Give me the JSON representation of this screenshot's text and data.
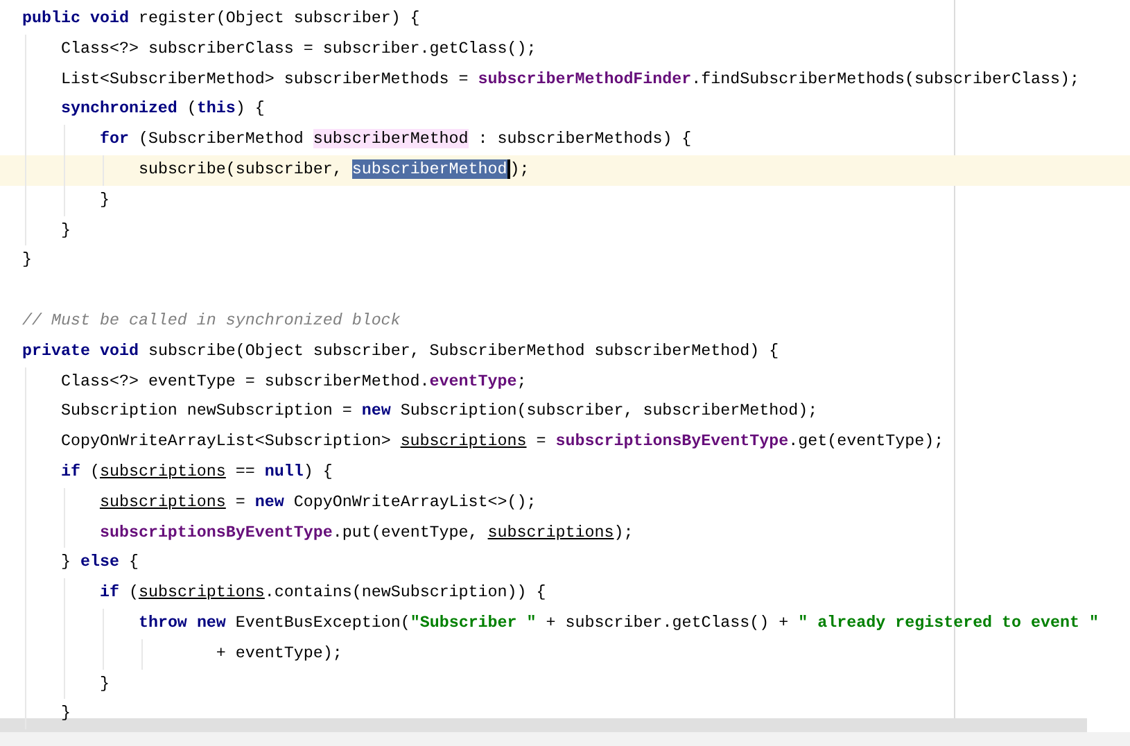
{
  "editor": {
    "lines": [
      {
        "current": false,
        "tokens": [
          {
            "kind": "keyword",
            "text": "public "
          },
          {
            "kind": "keyword",
            "text": "void"
          },
          {
            "kind": "plain",
            "text": " register(Object subscriber) {"
          }
        ]
      },
      {
        "current": false,
        "tokens": [
          {
            "kind": "plain",
            "text": "    Class<?> subscriberClass = subscriber.getClass();"
          }
        ]
      },
      {
        "current": false,
        "tokens": [
          {
            "kind": "plain",
            "text": "    List<SubscriberMethod> subscriberMethods = "
          },
          {
            "kind": "field",
            "text": "subscriberMethodFinder"
          },
          {
            "kind": "plain",
            "text": ".findSubscriberMethods(subscriberClass);"
          }
        ]
      },
      {
        "current": false,
        "tokens": [
          {
            "kind": "keyword",
            "text": "    synchronized"
          },
          {
            "kind": "plain",
            "text": " ("
          },
          {
            "kind": "keyword",
            "text": "this"
          },
          {
            "kind": "plain",
            "text": ") {"
          }
        ]
      },
      {
        "current": false,
        "tokens": [
          {
            "kind": "keyword",
            "text": "        for"
          },
          {
            "kind": "plain",
            "text": " (SubscriberMethod "
          },
          {
            "kind": "usage",
            "text": "subscriberMethod"
          },
          {
            "kind": "plain",
            "text": " : subscriberMethods) {"
          }
        ]
      },
      {
        "current": true,
        "tokens": [
          {
            "kind": "plain",
            "text": "            subscribe(subscriber, "
          },
          {
            "kind": "selected",
            "text": "subscriberMethod"
          },
          {
            "kind": "plain",
            "text": ");"
          }
        ]
      },
      {
        "current": false,
        "tokens": [
          {
            "kind": "plain",
            "text": "        }"
          }
        ]
      },
      {
        "current": false,
        "tokens": [
          {
            "kind": "plain",
            "text": "    }"
          }
        ]
      },
      {
        "current": false,
        "tokens": [
          {
            "kind": "plain",
            "text": "}"
          }
        ]
      },
      {
        "current": false
      },
      {
        "current": false,
        "tokens": [
          {
            "kind": "comment",
            "text": "// Must be called in synchronized block"
          }
        ]
      },
      {
        "current": false,
        "tokens": [
          {
            "kind": "keyword",
            "text": "private "
          },
          {
            "kind": "keyword",
            "text": "void"
          },
          {
            "kind": "plain",
            "text": " subscribe(Object subscriber, SubscriberMethod subscriberMethod) {"
          }
        ]
      },
      {
        "current": false,
        "tokens": [
          {
            "kind": "plain",
            "text": "    Class<?> eventType = subscriberMethod."
          },
          {
            "kind": "field",
            "text": "eventType"
          },
          {
            "kind": "plain",
            "text": ";"
          }
        ]
      },
      {
        "current": false,
        "tokens": [
          {
            "kind": "plain",
            "text": "    Subscription newSubscription = "
          },
          {
            "kind": "keyword",
            "text": "new"
          },
          {
            "kind": "plain",
            "text": " Subscription(subscriber, subscriberMethod);"
          }
        ]
      },
      {
        "current": false,
        "tokens": [
          {
            "kind": "plain",
            "text": "    CopyOnWriteArrayList<Subscription> "
          },
          {
            "kind": "local",
            "text": "subscriptions"
          },
          {
            "kind": "plain",
            "text": " = "
          },
          {
            "kind": "field",
            "text": "subscriptionsByEventType"
          },
          {
            "kind": "plain",
            "text": ".get(eventType);"
          }
        ]
      },
      {
        "current": false,
        "tokens": [
          {
            "kind": "keyword",
            "text": "    if"
          },
          {
            "kind": "plain",
            "text": " ("
          },
          {
            "kind": "local",
            "text": "subscriptions"
          },
          {
            "kind": "plain",
            "text": " == "
          },
          {
            "kind": "keyword",
            "text": "null"
          },
          {
            "kind": "plain",
            "text": ") {"
          }
        ]
      },
      {
        "current": false,
        "tokens": [
          {
            "kind": "local",
            "text": "        subscriptions"
          },
          {
            "kind": "plain",
            "text": " = "
          },
          {
            "kind": "keyword",
            "text": "new"
          },
          {
            "kind": "plain",
            "text": " CopyOnWriteArrayList<>();"
          }
        ]
      },
      {
        "current": false,
        "tokens": [
          {
            "kind": "field",
            "text": "        subscriptionsByEventType"
          },
          {
            "kind": "plain",
            "text": ".put(eventType, "
          },
          {
            "kind": "local",
            "text": "subscriptions"
          },
          {
            "kind": "plain",
            "text": ");"
          }
        ]
      },
      {
        "current": false,
        "tokens": [
          {
            "kind": "plain",
            "text": "    } "
          },
          {
            "kind": "keyword",
            "text": "else"
          },
          {
            "kind": "plain",
            "text": " {"
          }
        ]
      },
      {
        "current": false,
        "tokens": [
          {
            "kind": "keyword",
            "text": "        if"
          },
          {
            "kind": "plain",
            "text": " ("
          },
          {
            "kind": "local",
            "text": "subscriptions"
          },
          {
            "kind": "plain",
            "text": ".contains(newSubscription)) {"
          }
        ]
      },
      {
        "current": false,
        "tokens": [
          {
            "kind": "keyword",
            "text": "            throw "
          },
          {
            "kind": "keyword",
            "text": "new"
          },
          {
            "kind": "plain",
            "text": " EventBusException("
          },
          {
            "kind": "string",
            "text": "\"Subscriber \""
          },
          {
            "kind": "plain",
            "text": " + subscriber.getClass() + "
          },
          {
            "kind": "string",
            "text": "\" already registered to event \""
          }
        ]
      },
      {
        "current": false,
        "tokens": [
          {
            "kind": "plain",
            "text": "                    + eventType);"
          }
        ]
      },
      {
        "current": false,
        "tokens": [
          {
            "kind": "plain",
            "text": "        }"
          }
        ]
      },
      {
        "current": false,
        "tokens": [
          {
            "kind": "plain",
            "text": "    }"
          }
        ]
      }
    ]
  }
}
